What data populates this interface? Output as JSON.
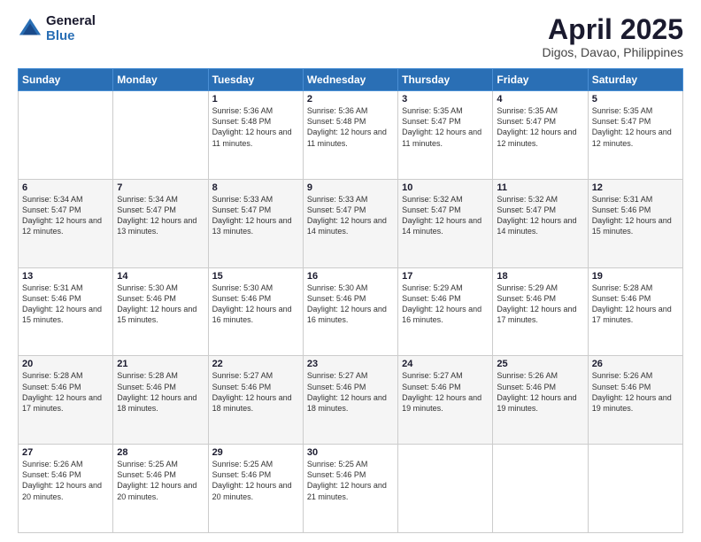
{
  "logo": {
    "general": "General",
    "blue": "Blue"
  },
  "header": {
    "title": "April 2025",
    "subtitle": "Digos, Davao, Philippines"
  },
  "weekdays": [
    "Sunday",
    "Monday",
    "Tuesday",
    "Wednesday",
    "Thursday",
    "Friday",
    "Saturday"
  ],
  "weeks": [
    [
      {
        "day": "",
        "sunrise": "",
        "sunset": "",
        "daylight": ""
      },
      {
        "day": "",
        "sunrise": "",
        "sunset": "",
        "daylight": ""
      },
      {
        "day": "1",
        "sunrise": "Sunrise: 5:36 AM",
        "sunset": "Sunset: 5:48 PM",
        "daylight": "Daylight: 12 hours and 11 minutes."
      },
      {
        "day": "2",
        "sunrise": "Sunrise: 5:36 AM",
        "sunset": "Sunset: 5:48 PM",
        "daylight": "Daylight: 12 hours and 11 minutes."
      },
      {
        "day": "3",
        "sunrise": "Sunrise: 5:35 AM",
        "sunset": "Sunset: 5:47 PM",
        "daylight": "Daylight: 12 hours and 11 minutes."
      },
      {
        "day": "4",
        "sunrise": "Sunrise: 5:35 AM",
        "sunset": "Sunset: 5:47 PM",
        "daylight": "Daylight: 12 hours and 12 minutes."
      },
      {
        "day": "5",
        "sunrise": "Sunrise: 5:35 AM",
        "sunset": "Sunset: 5:47 PM",
        "daylight": "Daylight: 12 hours and 12 minutes."
      }
    ],
    [
      {
        "day": "6",
        "sunrise": "Sunrise: 5:34 AM",
        "sunset": "Sunset: 5:47 PM",
        "daylight": "Daylight: 12 hours and 12 minutes."
      },
      {
        "day": "7",
        "sunrise": "Sunrise: 5:34 AM",
        "sunset": "Sunset: 5:47 PM",
        "daylight": "Daylight: 12 hours and 13 minutes."
      },
      {
        "day": "8",
        "sunrise": "Sunrise: 5:33 AM",
        "sunset": "Sunset: 5:47 PM",
        "daylight": "Daylight: 12 hours and 13 minutes."
      },
      {
        "day": "9",
        "sunrise": "Sunrise: 5:33 AM",
        "sunset": "Sunset: 5:47 PM",
        "daylight": "Daylight: 12 hours and 14 minutes."
      },
      {
        "day": "10",
        "sunrise": "Sunrise: 5:32 AM",
        "sunset": "Sunset: 5:47 PM",
        "daylight": "Daylight: 12 hours and 14 minutes."
      },
      {
        "day": "11",
        "sunrise": "Sunrise: 5:32 AM",
        "sunset": "Sunset: 5:47 PM",
        "daylight": "Daylight: 12 hours and 14 minutes."
      },
      {
        "day": "12",
        "sunrise": "Sunrise: 5:31 AM",
        "sunset": "Sunset: 5:46 PM",
        "daylight": "Daylight: 12 hours and 15 minutes."
      }
    ],
    [
      {
        "day": "13",
        "sunrise": "Sunrise: 5:31 AM",
        "sunset": "Sunset: 5:46 PM",
        "daylight": "Daylight: 12 hours and 15 minutes."
      },
      {
        "day": "14",
        "sunrise": "Sunrise: 5:30 AM",
        "sunset": "Sunset: 5:46 PM",
        "daylight": "Daylight: 12 hours and 15 minutes."
      },
      {
        "day": "15",
        "sunrise": "Sunrise: 5:30 AM",
        "sunset": "Sunset: 5:46 PM",
        "daylight": "Daylight: 12 hours and 16 minutes."
      },
      {
        "day": "16",
        "sunrise": "Sunrise: 5:30 AM",
        "sunset": "Sunset: 5:46 PM",
        "daylight": "Daylight: 12 hours and 16 minutes."
      },
      {
        "day": "17",
        "sunrise": "Sunrise: 5:29 AM",
        "sunset": "Sunset: 5:46 PM",
        "daylight": "Daylight: 12 hours and 16 minutes."
      },
      {
        "day": "18",
        "sunrise": "Sunrise: 5:29 AM",
        "sunset": "Sunset: 5:46 PM",
        "daylight": "Daylight: 12 hours and 17 minutes."
      },
      {
        "day": "19",
        "sunrise": "Sunrise: 5:28 AM",
        "sunset": "Sunset: 5:46 PM",
        "daylight": "Daylight: 12 hours and 17 minutes."
      }
    ],
    [
      {
        "day": "20",
        "sunrise": "Sunrise: 5:28 AM",
        "sunset": "Sunset: 5:46 PM",
        "daylight": "Daylight: 12 hours and 17 minutes."
      },
      {
        "day": "21",
        "sunrise": "Sunrise: 5:28 AM",
        "sunset": "Sunset: 5:46 PM",
        "daylight": "Daylight: 12 hours and 18 minutes."
      },
      {
        "day": "22",
        "sunrise": "Sunrise: 5:27 AM",
        "sunset": "Sunset: 5:46 PM",
        "daylight": "Daylight: 12 hours and 18 minutes."
      },
      {
        "day": "23",
        "sunrise": "Sunrise: 5:27 AM",
        "sunset": "Sunset: 5:46 PM",
        "daylight": "Daylight: 12 hours and 18 minutes."
      },
      {
        "day": "24",
        "sunrise": "Sunrise: 5:27 AM",
        "sunset": "Sunset: 5:46 PM",
        "daylight": "Daylight: 12 hours and 19 minutes."
      },
      {
        "day": "25",
        "sunrise": "Sunrise: 5:26 AM",
        "sunset": "Sunset: 5:46 PM",
        "daylight": "Daylight: 12 hours and 19 minutes."
      },
      {
        "day": "26",
        "sunrise": "Sunrise: 5:26 AM",
        "sunset": "Sunset: 5:46 PM",
        "daylight": "Daylight: 12 hours and 19 minutes."
      }
    ],
    [
      {
        "day": "27",
        "sunrise": "Sunrise: 5:26 AM",
        "sunset": "Sunset: 5:46 PM",
        "daylight": "Daylight: 12 hours and 20 minutes."
      },
      {
        "day": "28",
        "sunrise": "Sunrise: 5:25 AM",
        "sunset": "Sunset: 5:46 PM",
        "daylight": "Daylight: 12 hours and 20 minutes."
      },
      {
        "day": "29",
        "sunrise": "Sunrise: 5:25 AM",
        "sunset": "Sunset: 5:46 PM",
        "daylight": "Daylight: 12 hours and 20 minutes."
      },
      {
        "day": "30",
        "sunrise": "Sunrise: 5:25 AM",
        "sunset": "Sunset: 5:46 PM",
        "daylight": "Daylight: 12 hours and 21 minutes."
      },
      {
        "day": "",
        "sunrise": "",
        "sunset": "",
        "daylight": ""
      },
      {
        "day": "",
        "sunrise": "",
        "sunset": "",
        "daylight": ""
      },
      {
        "day": "",
        "sunrise": "",
        "sunset": "",
        "daylight": ""
      }
    ]
  ]
}
